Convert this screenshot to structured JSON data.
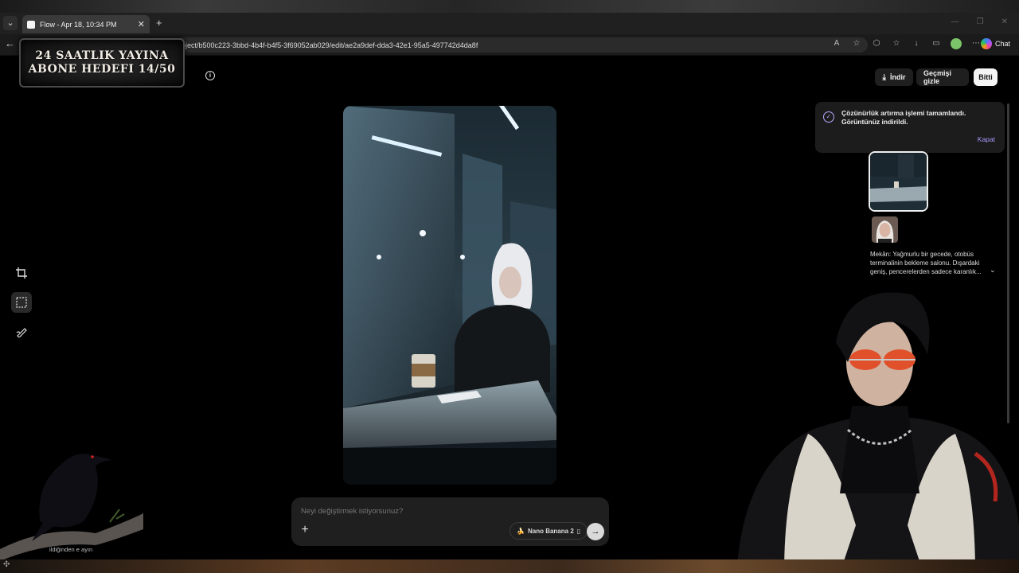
{
  "browser": {
    "tab_title": "Flow - Apr 18, 10:34 PM",
    "url": "oject/b500c223-3bbd-4b4f-b4f5-3f69052ab029/edit/ae2a9def-dda3-42e1-95a5-497742d4da8f",
    "chat_label": "Chat",
    "tab_list_icon": "chevron-down-icon",
    "close_tab_icon": "close-icon"
  },
  "overlay": {
    "goal_line1": "24 SAATLIK YAYINA",
    "goal_line2": "ABONE HEDEFI 14/50"
  },
  "toolbar": {
    "download_label": "İndir",
    "hide_history_label": "Geçmişi gizle",
    "done_label": "Bitti"
  },
  "toast": {
    "message": "Çözünürlük artırma işlemi tamamlandı. Görüntünüz indirildi.",
    "close_label": "Kapat"
  },
  "panel": {
    "prompt_preview": "Mekân: Yağmurlu bir gecede, otobüs terminalinin bekleme salonu. Dışardaki geniş, pencerelerden sadece karanlık..."
  },
  "composer": {
    "placeholder": "Neyi değiştirmek istiyorsunuz?",
    "model_label": "Nano Banana 2"
  },
  "footer": {
    "hint": "ildiğinden e                              ayın"
  },
  "colors": {
    "background": "#000000",
    "toast_accent": "#a99bff",
    "surface": "#1f1f1f"
  }
}
